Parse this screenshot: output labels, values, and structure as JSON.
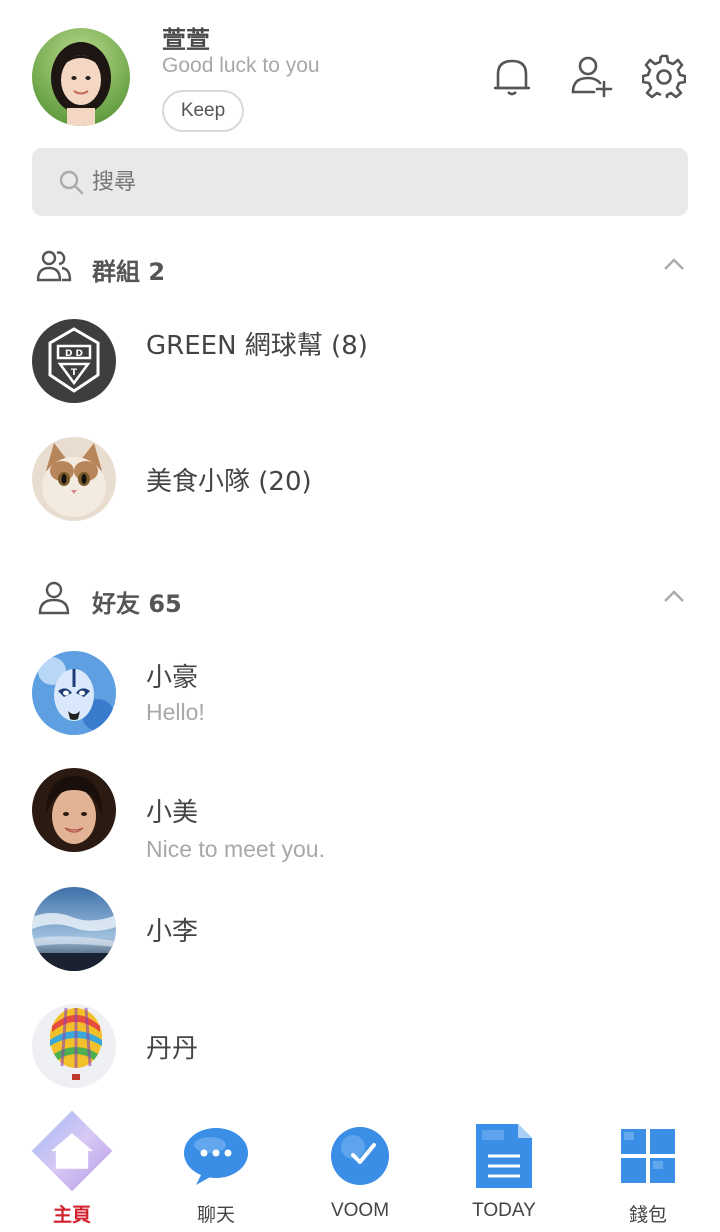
{
  "profile": {
    "name": "萱萱",
    "status": "Good luck to you",
    "keep_label": "Keep"
  },
  "header_icons": [
    "bell-icon",
    "add-friend-icon",
    "gear-icon"
  ],
  "search": {
    "placeholder": "搜尋"
  },
  "groups": {
    "title": "群組 2",
    "items": [
      {
        "name": "GREEN 網球幫 (8)"
      },
      {
        "name": "美食小隊 (20)"
      }
    ]
  },
  "friends": {
    "title": "好友 65",
    "items": [
      {
        "name": "小豪",
        "status": "Hello!"
      },
      {
        "name": "小美",
        "status": "Nice to meet you."
      },
      {
        "name": "小李",
        "status": ""
      },
      {
        "name": "丹丹",
        "status": ""
      }
    ]
  },
  "tabs": [
    {
      "label": "主頁",
      "icon": "home-icon",
      "active": true
    },
    {
      "label": "聊天",
      "icon": "chat-icon",
      "active": false
    },
    {
      "label": "VOOM",
      "icon": "clock-icon",
      "active": false
    },
    {
      "label": "TODAY",
      "icon": "news-icon",
      "active": false
    },
    {
      "label": "錢包",
      "icon": "wallet-grid-icon",
      "active": false
    }
  ],
  "colors": {
    "accent": "#d2212c",
    "icon_blue": "#3a8ee6",
    "search_bg": "#e9e9e9",
    "muted_text": "#a8a8a8"
  }
}
